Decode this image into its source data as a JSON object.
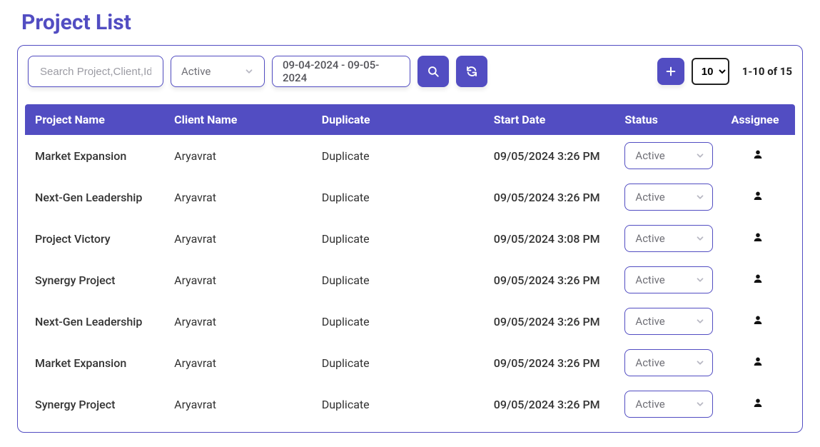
{
  "colors": {
    "accent": "#524dc2",
    "muted": "#6f6f76",
    "chev": "#b7b7c2",
    "text": "#333333",
    "white": "#ffffff"
  },
  "page": {
    "title": "Project List"
  },
  "toolbar": {
    "search_placeholder": "Search Project,Client,Id",
    "status_filter_value": "Active",
    "date_range_value": "09-04-2024 - 09-05-2024",
    "page_size_value": "10",
    "pagination_text": "1-10 of 15"
  },
  "table": {
    "headers": {
      "project_name": "Project Name",
      "client_name": "Client Name",
      "duplicate": "Duplicate",
      "start_date": "Start Date",
      "status": "Status",
      "assignee": "Assignee"
    },
    "rows": [
      {
        "project": "Market Expansion",
        "client": "Aryavrat",
        "duplicate": "Duplicate",
        "start": "09/05/2024 3:26 PM",
        "status": "Active"
      },
      {
        "project": "Next-Gen Leadership",
        "client": "Aryavrat",
        "duplicate": "Duplicate",
        "start": "09/05/2024 3:26 PM",
        "status": "Active"
      },
      {
        "project": "Project Victory",
        "client": "Aryavrat",
        "duplicate": "Duplicate",
        "start": "09/05/2024 3:08 PM",
        "status": "Active"
      },
      {
        "project": "Synergy Project",
        "client": "Aryavrat",
        "duplicate": "Duplicate",
        "start": "09/05/2024 3:26 PM",
        "status": "Active"
      },
      {
        "project": "Next-Gen Leadership",
        "client": "Aryavrat",
        "duplicate": "Duplicate",
        "start": "09/05/2024 3:26 PM",
        "status": "Active"
      },
      {
        "project": "Market Expansion",
        "client": "Aryavrat",
        "duplicate": "Duplicate",
        "start": "09/05/2024 3:26 PM",
        "status": "Active"
      },
      {
        "project": "Synergy Project",
        "client": "Aryavrat",
        "duplicate": "Duplicate",
        "start": "09/05/2024 3:26 PM",
        "status": "Active"
      }
    ]
  }
}
